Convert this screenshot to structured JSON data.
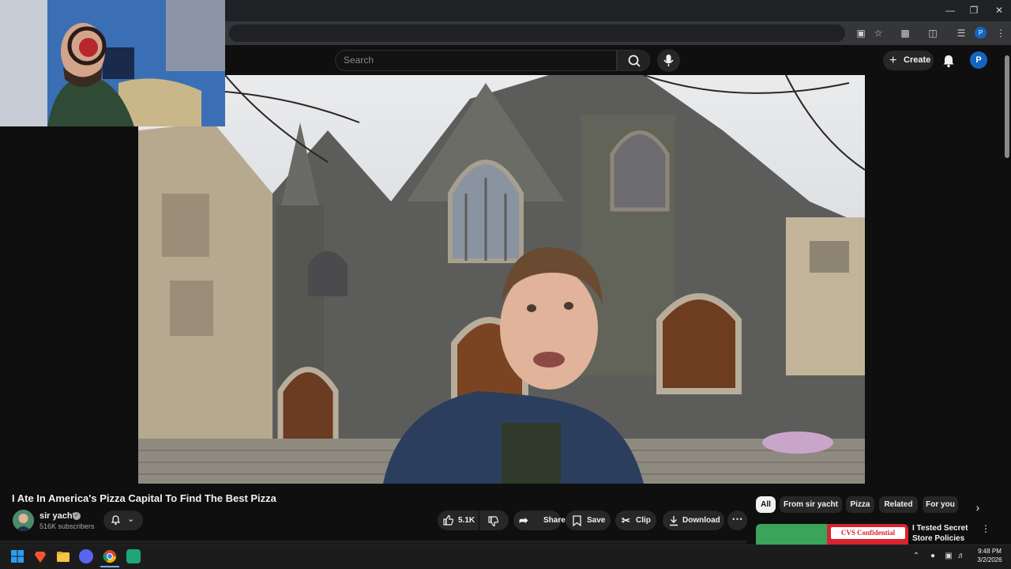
{
  "youtube": {
    "search_placeholder": "Search",
    "create_label": "Create",
    "account_initial": "P"
  },
  "video": {
    "title": "I Ate In America's Pizza Capital To Find The Best Pizza",
    "channel_name": "sir yacht",
    "subscribers": "516K subscribers",
    "likes": "5.1K",
    "actions": {
      "share": "Share",
      "save": "Save",
      "clip": "Clip",
      "download": "Download"
    }
  },
  "chips": [
    {
      "label": "All",
      "active": true
    },
    {
      "label": "From sir yacht",
      "active": false
    },
    {
      "label": "Pizza",
      "active": false
    },
    {
      "label": "Related",
      "active": false
    },
    {
      "label": "For you",
      "active": false
    }
  ],
  "related": [
    {
      "title": "I Tested Secret Store Policies",
      "thumb_text": "CVS Confidential"
    }
  ],
  "taskbar": {
    "time": "9:48 PM",
    "date": "3/2/2026",
    "apps": [
      "windows-start-icon",
      "brave-icon",
      "file-explorer-icon",
      "discord-icon",
      "chrome-icon",
      "android-app-icon"
    ]
  },
  "colors": {
    "background": "#0f0f0f",
    "button": "#272727",
    "accent_blue": "#1565c0",
    "chip_active": "#f1f1f1"
  }
}
